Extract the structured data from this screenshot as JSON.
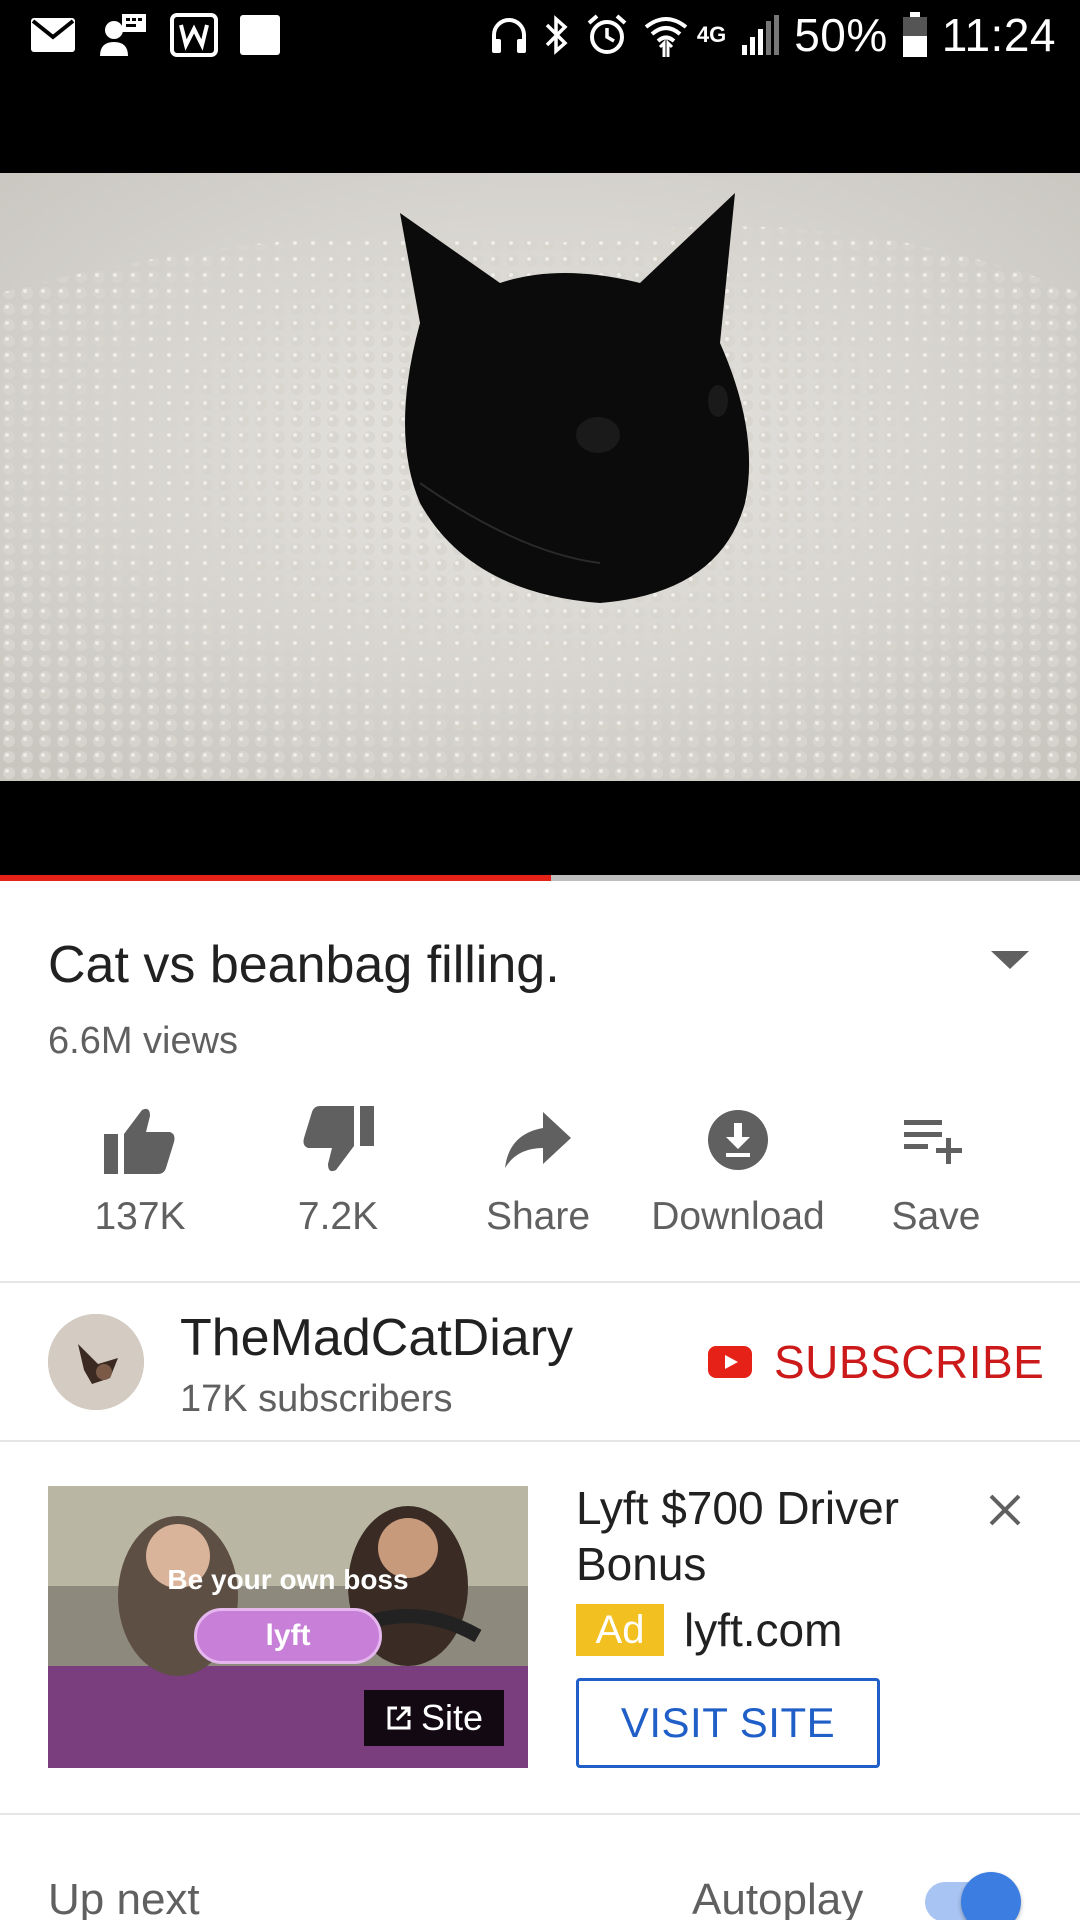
{
  "status_bar": {
    "battery": "50%",
    "time": "11:24",
    "network": "4G",
    "left_icons": [
      "mail-icon",
      "account-switch-icon",
      "w-app-icon",
      "square-icon"
    ],
    "right_icons": [
      "headphones-icon",
      "bluetooth-icon",
      "alarm-icon",
      "wifi-icon",
      "signal-icon",
      "battery-icon"
    ]
  },
  "player": {
    "progress_fraction": 0.51,
    "progress_color": "#e62117"
  },
  "video": {
    "title": "Cat vs beanbag filling.",
    "views": "6.6M views"
  },
  "actions": [
    {
      "icon": "thumbs-up-icon",
      "label": "137K"
    },
    {
      "icon": "thumbs-down-icon",
      "label": "7.2K"
    },
    {
      "icon": "share-icon",
      "label": "Share"
    },
    {
      "icon": "download-icon",
      "label": "Download"
    },
    {
      "icon": "add-to-playlist-icon",
      "label": "Save"
    }
  ],
  "channel": {
    "name": "TheMadCatDiary",
    "subscribers": "17K subscribers",
    "subscribe_label": "SUBSCRIBE",
    "subscribe_color": "#cc1a1a"
  },
  "ad": {
    "tagline": "Be your own boss",
    "logo_text": "lyft",
    "site_badge": "Site",
    "title": "Lyft $700 Driver Bonus",
    "badge": "Ad",
    "domain": "lyft.com",
    "cta": "VISIT SITE",
    "badge_color": "#f3c022",
    "cta_color": "#1f5fc7"
  },
  "up_next": {
    "label": "Up next",
    "autoplay_label": "Autoplay",
    "autoplay_on": true
  }
}
